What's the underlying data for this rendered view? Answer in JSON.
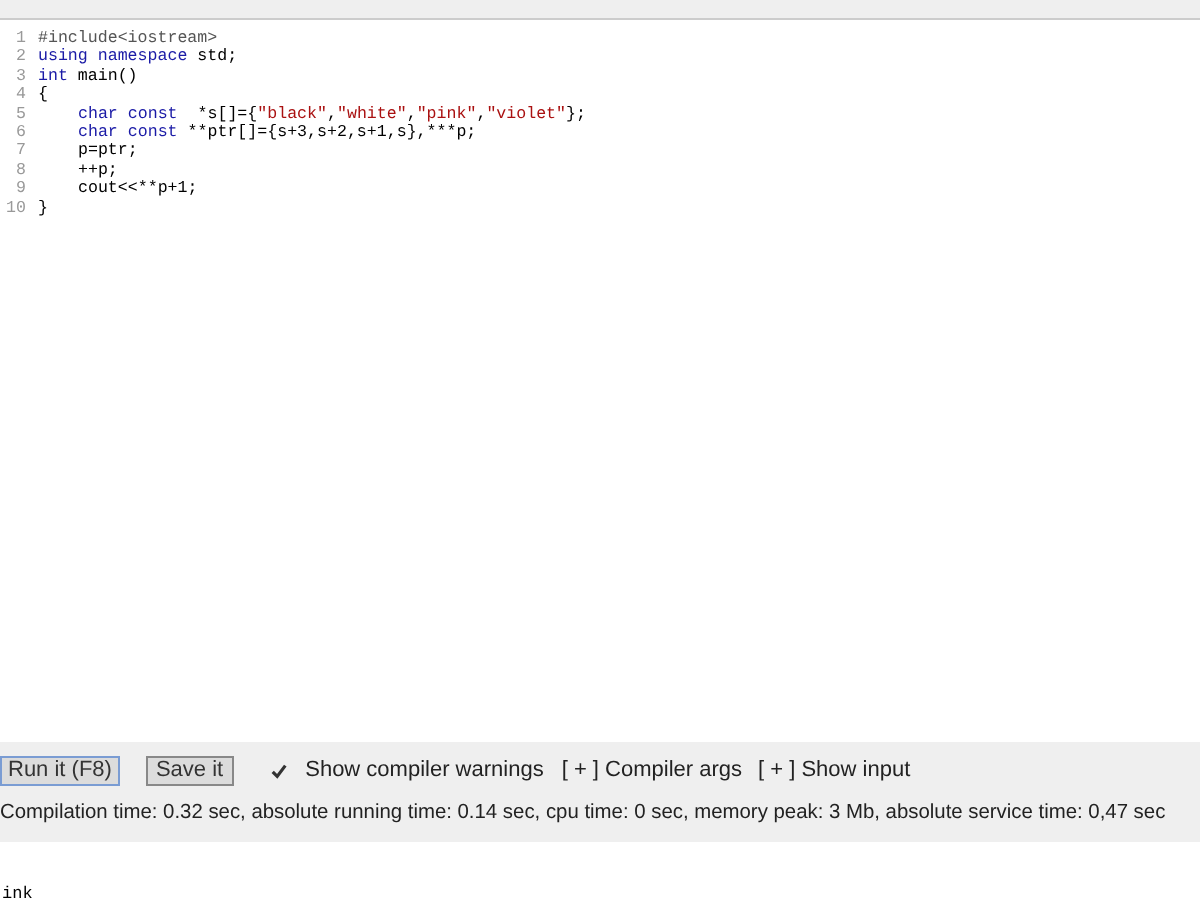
{
  "editor": {
    "lines": [
      {
        "number": "1",
        "indented": false,
        "tokens": [
          {
            "kind": "meta",
            "text": "#include<iostream>"
          }
        ]
      },
      {
        "number": "2",
        "indented": false,
        "tokens": [
          {
            "kind": "keyword",
            "text": "using namespace"
          },
          {
            "kind": "plain",
            "text": " std;"
          }
        ]
      },
      {
        "number": "3",
        "indented": false,
        "tokens": [
          {
            "kind": "keyword",
            "text": "int"
          },
          {
            "kind": "plain",
            "text": " main()"
          }
        ]
      },
      {
        "number": "4",
        "indented": false,
        "tokens": [
          {
            "kind": "plain",
            "text": "{"
          }
        ]
      },
      {
        "number": "5",
        "indented": true,
        "tokens": [
          {
            "kind": "keyword",
            "text": "char const"
          },
          {
            "kind": "plain",
            "text": "  *s[]={"
          },
          {
            "kind": "string",
            "text": "\"black\""
          },
          {
            "kind": "plain",
            "text": ","
          },
          {
            "kind": "string",
            "text": "\"white\""
          },
          {
            "kind": "plain",
            "text": ","
          },
          {
            "kind": "string",
            "text": "\"pink\""
          },
          {
            "kind": "plain",
            "text": ","
          },
          {
            "kind": "string",
            "text": "\"violet\""
          },
          {
            "kind": "plain",
            "text": "};"
          }
        ]
      },
      {
        "number": "6",
        "indented": true,
        "tokens": [
          {
            "kind": "keyword",
            "text": "char const"
          },
          {
            "kind": "plain",
            "text": " **ptr[]={s+3,s+2,s+1,s},***p;"
          }
        ]
      },
      {
        "number": "7",
        "indented": true,
        "tokens": [
          {
            "kind": "plain",
            "text": "p=ptr;"
          }
        ]
      },
      {
        "number": "8",
        "indented": true,
        "tokens": [
          {
            "kind": "plain",
            "text": "++p;"
          }
        ]
      },
      {
        "number": "9",
        "indented": true,
        "tokens": [
          {
            "kind": "plain",
            "text": "cout<<**p+1;"
          }
        ]
      },
      {
        "number": "10",
        "indented": false,
        "tokens": [
          {
            "kind": "plain",
            "text": "}"
          }
        ]
      }
    ]
  },
  "toolbar": {
    "run_button": "Run it (F8)",
    "save_button": "Save it",
    "warnings": {
      "label": "Show compiler warnings",
      "checked": true
    },
    "links": [
      "[ + ] Compiler args",
      "[ + ] Show input"
    ]
  },
  "stats": "Compilation time: 0.32 sec, absolute running time: 0.14 sec, cpu time: 0 sec, memory peak: 3 Mb, absolute service time: 0,47 sec",
  "output": "ink"
}
